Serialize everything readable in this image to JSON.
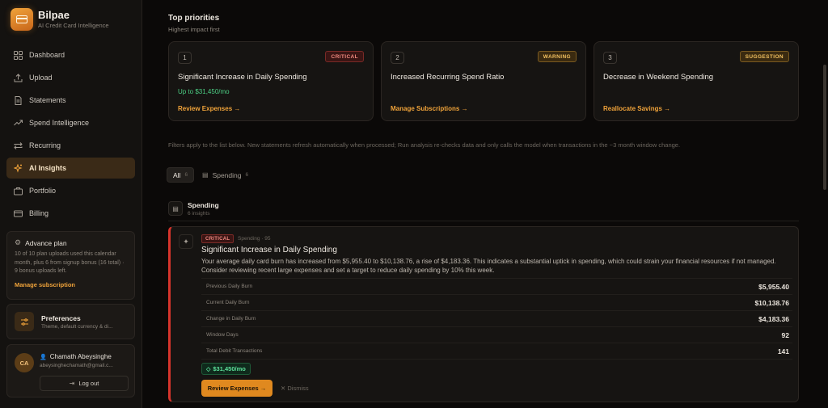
{
  "brand": {
    "name": "Bilpae",
    "subtitle": "AI Credit Card Intelligence"
  },
  "sidebar": {
    "items": [
      {
        "label": "Dashboard",
        "icon": "dashboard-icon"
      },
      {
        "label": "Upload",
        "icon": "upload-icon"
      },
      {
        "label": "Statements",
        "icon": "document-icon"
      },
      {
        "label": "Spend Intelligence",
        "icon": "trend-icon"
      },
      {
        "label": "Recurring",
        "icon": "repeat-icon"
      },
      {
        "label": "AI Insights",
        "icon": "sparkle-icon",
        "active": true
      },
      {
        "label": "Portfolio",
        "icon": "briefcase-icon"
      },
      {
        "label": "Billing",
        "icon": "credit-card-icon"
      }
    ],
    "plan": {
      "title": "Advance plan",
      "desc": "10 of 10 plan uploads used this calendar month, plus 6 from signup bonus (16 total) · 9 bonus uploads left.",
      "link": "Manage subscription"
    },
    "preferences": {
      "title": "Preferences",
      "subtitle": "Theme, default currency & di..."
    },
    "user": {
      "initials": "CA",
      "name": "Chamath Abeysinghe",
      "email": "abeysinghechamath@gmail.c...",
      "logout": "Log out"
    }
  },
  "priorities": {
    "title": "Top priorities",
    "subtitle": "Highest impact first",
    "cards": [
      {
        "num": "1",
        "badge": "CRITICAL",
        "title": "Significant Increase in Daily Spending",
        "extra": "Up to $31,450/mo",
        "action": "Review Expenses →"
      },
      {
        "num": "2",
        "badge": "WARNING",
        "title": "Increased Recurring Spend Ratio",
        "extra": "",
        "action": "Manage Subscriptions →"
      },
      {
        "num": "3",
        "badge": "SUGGESTION",
        "title": "Decrease in Weekend Spending",
        "extra": "",
        "action": "Reallocate Savings →"
      }
    ]
  },
  "filter_note": "Filters apply to the list below. New statements refresh automatically when processed; Run analysis re-checks data and only calls the model when transactions in the ~3 month window change.",
  "tabs": [
    {
      "label": "All",
      "count": "6"
    },
    {
      "label": "Spending",
      "count": "6"
    }
  ],
  "group": {
    "title": "Spending",
    "subtitle": "6 insights"
  },
  "insight": {
    "badge": "CRITICAL",
    "meta": "Spending · 95",
    "title": "Significant Increase in Daily Spending",
    "desc": "Your average daily card burn has increased from $5,955.40 to $10,138.76, a rise of $4,183.36. This indicates a substantial uptick in spending, which could strain your financial resources if not managed. Consider reviewing recent large expenses and set a target to reduce daily spending by 10% this week.",
    "metrics": [
      {
        "label": "Previous Daily Burn",
        "value": "$5,955.40"
      },
      {
        "label": "Current Daily Burn",
        "value": "$10,138.76"
      },
      {
        "label": "Change in Daily Burn",
        "value": "$4,183.36"
      },
      {
        "label": "Window Days",
        "value": "92"
      },
      {
        "label": "Total Debit Transactions",
        "value": "141"
      }
    ],
    "impact": "$31,450/mo",
    "action": "Review Expenses →",
    "dismiss": "Dismiss"
  }
}
